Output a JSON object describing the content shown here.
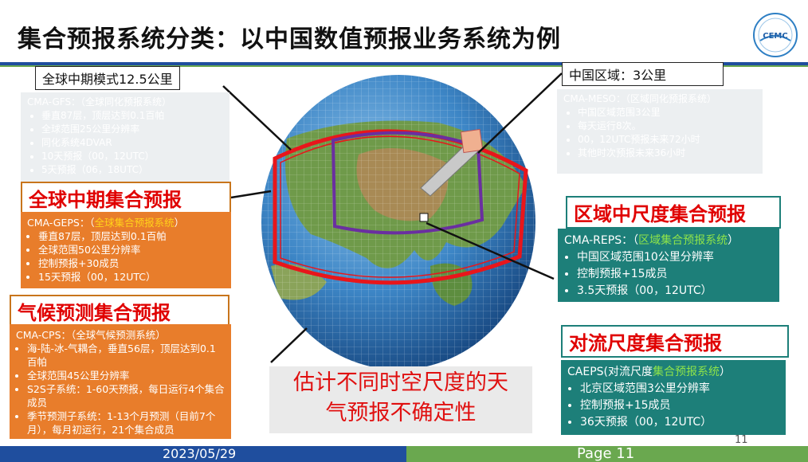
{
  "title": "集合预报系统分类：以中国数值预报业务系统为例",
  "logo": {
    "text": "CEMC"
  },
  "labels": {
    "global_model": "全球中期模式12.5公里",
    "china_region": "中国区域：3公里"
  },
  "ghost_global": {
    "head": "CMA-GFS：（全球同化预报系统）",
    "items": [
      "垂直87层，顶层达到0.1百帕",
      "全球范围25公里分辨率",
      "同化系统4DVAR",
      "10天预报（00，12UTC）",
      "5天预报（06，18UTC）"
    ]
  },
  "ghost_meso": {
    "head": "CMA-MESO：（区域同化预报系统）",
    "items": [
      "中国区域范围3公里",
      "每天运行8次。",
      "00，12UTC预报未来72小时",
      "其他时次预报未来36小时"
    ]
  },
  "geps": {
    "title": "全球中期集合预报",
    "head_prefix": "CMA-GEPS：（",
    "head_highlight": "全球集合预报系统",
    "head_suffix": "）",
    "items": [
      "垂直87层，顶层达到0.1百帕",
      "全球范围50公里分辨率",
      "控制预报+30成员",
      "15天预报（00，12UTC）"
    ]
  },
  "cps": {
    "title": "气候预测集合预报",
    "head": "CMA-CPS：（全球气候预测系统）",
    "items": [
      "海-陆-冰-气耦合，垂直56层，顶层达到0.1百帕",
      "全球范围45公里分辨率",
      "S2S子系统：1-60天预报，每日运行4个集合成员",
      "季节预测子系统：1-13个月预测（目前7个月），每月初运行，21个集合成员"
    ]
  },
  "reps": {
    "title": "区域中尺度集合预报",
    "head_prefix": "CMA-REPS：（",
    "head_highlight": "区域集合预报系统",
    "head_suffix": "）",
    "items": [
      "中国区域范围10公里分辨率",
      "控制预报+15成员",
      "3.5天预报（00，12UTC）"
    ]
  },
  "caeps": {
    "title": "对流尺度集合预报",
    "head_prefix": "CAEPS(对流尺度",
    "head_highlight": "集合预报系统",
    "head_suffix": "）",
    "items": [
      "北京区域范围3公里分辨率",
      "控制预报+15成员",
      "36天预报（00，12UTC）"
    ]
  },
  "center_text": {
    "line1": "估计不同时空尺度的天",
    "line2": "气预报不确定性"
  },
  "footer": {
    "date": "2023/05/29",
    "page": "Page 11",
    "page_number": "11"
  },
  "colors": {
    "title_red": "#e00000",
    "orange_box": "#e87d2b",
    "teal_box": "#1d7f79",
    "footer_blue": "#1f4e9e",
    "footer_green": "#6aa84f",
    "globe_ring": "#e8161b",
    "inner_domain": "#6a2fa0"
  }
}
